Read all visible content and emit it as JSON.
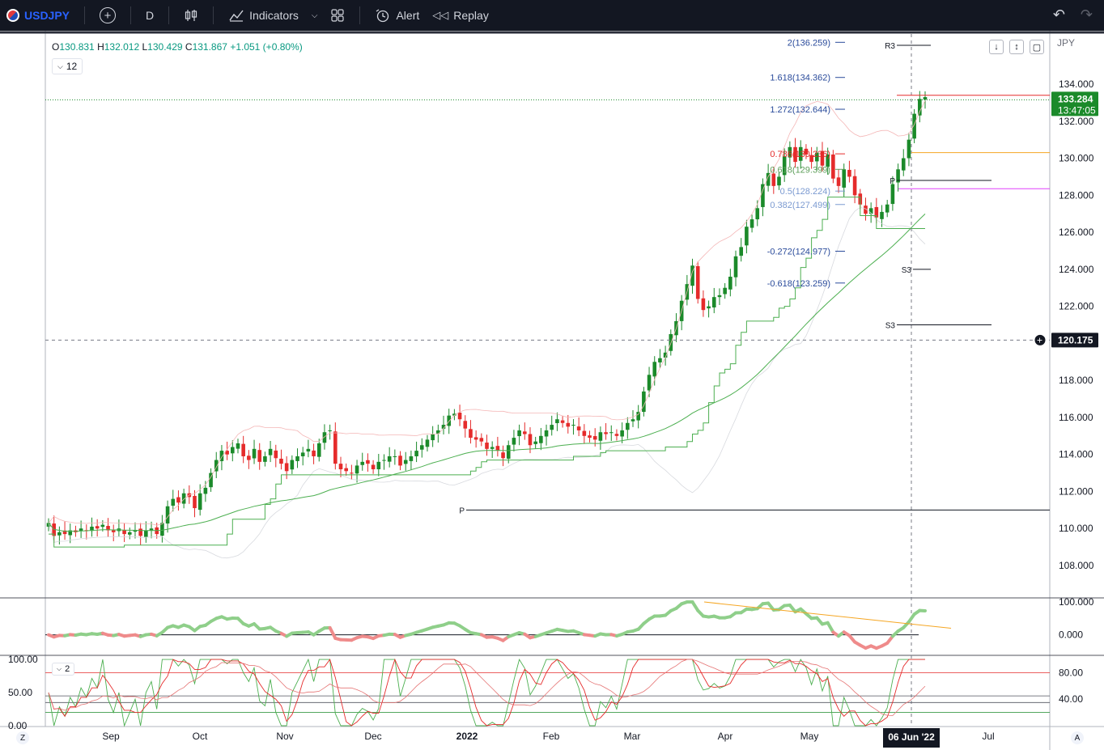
{
  "toolbar": {
    "symbol": "USDJPY",
    "interval": "D",
    "indicators_label": "Indicators",
    "alert_label": "Alert",
    "replay_label": "Replay"
  },
  "legend": {
    "open_label": "O",
    "open": "130.831",
    "high_label": "H",
    "high": "132.012",
    "low_label": "L",
    "low": "130.429",
    "close_label": "C",
    "close": "131.867",
    "change": "+1.051 (+0.80%)",
    "indicator_badge": "12",
    "indicator_badge2": "2"
  },
  "currency": "JPY",
  "colors": {
    "up": "#1b8a2a",
    "down": "#e52b2b",
    "toolbar_bg": "#131722",
    "accent": "#2962ff",
    "ma_green": "#4caf50",
    "fib_blue": "#2a4b9b",
    "orange": "#f5a623",
    "magenta": "#e040fb"
  },
  "chart_data": [
    {
      "type": "candlestick",
      "symbol": "USDJPY",
      "yaxis_ticks": [
        "134.000",
        "132.000",
        "130.000",
        "128.000",
        "126.000",
        "124.000",
        "122.000",
        "120.000",
        "118.000",
        "116.000",
        "114.000",
        "112.000",
        "110.000",
        "108.000"
      ],
      "ylim": [
        107,
        136.5
      ],
      "xaxis_ticks": [
        "Sep",
        "Oct",
        "Nov",
        "Dec",
        "2022",
        "Feb",
        "Mar",
        "Apr",
        "May",
        "Jun",
        "Jul"
      ],
      "xaxis_highlight": "06 Jun '22",
      "last_price_label": "133.284",
      "countdown_label": "13:47:05",
      "crosshair_price_label": "120.175",
      "fib_levels": [
        {
          "label": "2(136.259)",
          "value": 136.259
        },
        {
          "label": "1.618(134.362)",
          "value": 134.362
        },
        {
          "label": "1.272(132.644)",
          "value": 132.644
        },
        {
          "label": "0.786(130.236)",
          "value": 130.236
        },
        {
          "label": "0.618(129.399)",
          "value": 129.399
        },
        {
          "label": "0.5(128.224)",
          "value": 128.224
        },
        {
          "label": "0.382(127.499)",
          "value": 127.499
        },
        {
          "label": "-0.272(124.977)",
          "value": 124.977
        },
        {
          "label": "-0.618(123.259)",
          "value": 123.259
        }
      ],
      "pivot_labels": [
        {
          "label": "R3",
          "value": 136.1
        },
        {
          "label": "P",
          "value": 128.8
        },
        {
          "label": "S3",
          "value": 124.0
        },
        {
          "label": "S3",
          "value": 121.0
        },
        {
          "label": "P",
          "value": 111.0
        }
      ],
      "series_close": [
        110.3,
        109.6,
        109.8,
        109.7,
        109.9,
        109.8,
        110.0,
        109.9,
        110.1,
        110.0,
        110.2,
        109.9,
        109.8,
        110.0,
        109.7,
        109.8,
        109.9,
        109.6,
        109.9,
        110.0,
        109.7,
        110.3,
        111.2,
        111.6,
        111.4,
        111.9,
        111.7,
        111.1,
        111.9,
        112.2,
        113.0,
        113.7,
        114.2,
        114.0,
        114.4,
        114.6,
        113.9,
        113.7,
        114.3,
        113.6,
        113.9,
        114.3,
        113.8,
        113.5,
        113.1,
        113.7,
        113.9,
        114.1,
        114.3,
        113.9,
        114.6,
        115.2,
        115.3,
        113.5,
        113.2,
        113.1,
        113.0,
        113.4,
        113.6,
        113.5,
        113.2,
        113.6,
        113.7,
        113.9,
        113.9,
        113.4,
        113.7,
        113.9,
        114.2,
        114.5,
        114.8,
        115.1,
        115.3,
        115.6,
        116.1,
        116.2,
        115.9,
        115.4,
        114.9,
        114.8,
        114.7,
        114.3,
        114.4,
        114.2,
        113.8,
        114.5,
        114.9,
        115.3,
        115.1,
        114.5,
        114.7,
        115.0,
        115.3,
        115.6,
        115.9,
        115.7,
        115.5,
        115.6,
        115.3,
        115.0,
        114.9,
        114.8,
        115.2,
        115.1,
        115.2,
        115.0,
        115.3,
        115.7,
        115.9,
        116.3,
        117.4,
        118.3,
        119.0,
        119.2,
        119.5,
        120.5,
        121.2,
        122.3,
        123.2,
        124.2,
        122.4,
        121.8,
        122.0,
        122.5,
        122.6,
        123.0,
        123.6,
        124.7,
        125.2,
        126.3,
        126.7,
        127.3,
        128.6,
        129.2,
        128.5,
        129.0,
        130.1,
        130.6,
        129.8,
        130.6,
        130.2,
        129.8,
        130.3,
        129.6,
        130.2,
        128.9,
        128.5,
        129.4,
        129.0,
        128.0,
        127.5,
        127.0,
        127.3,
        126.8,
        127.1,
        127.5,
        128.6,
        129.4,
        130.0,
        131.0,
        132.4,
        133.2,
        133.3
      ]
    },
    {
      "type": "line",
      "name_shown": "",
      "yaxis_ticks": [
        "100.000",
        "0.000"
      ],
      "ylim": [
        -60,
        110
      ]
    },
    {
      "type": "line",
      "yaxis_ticks_left": [
        "100.00",
        "50.00",
        "0.00"
      ],
      "yaxis_ticks_right": [
        "80.00",
        "40.00"
      ],
      "ylim": [
        0,
        105
      ]
    }
  ]
}
